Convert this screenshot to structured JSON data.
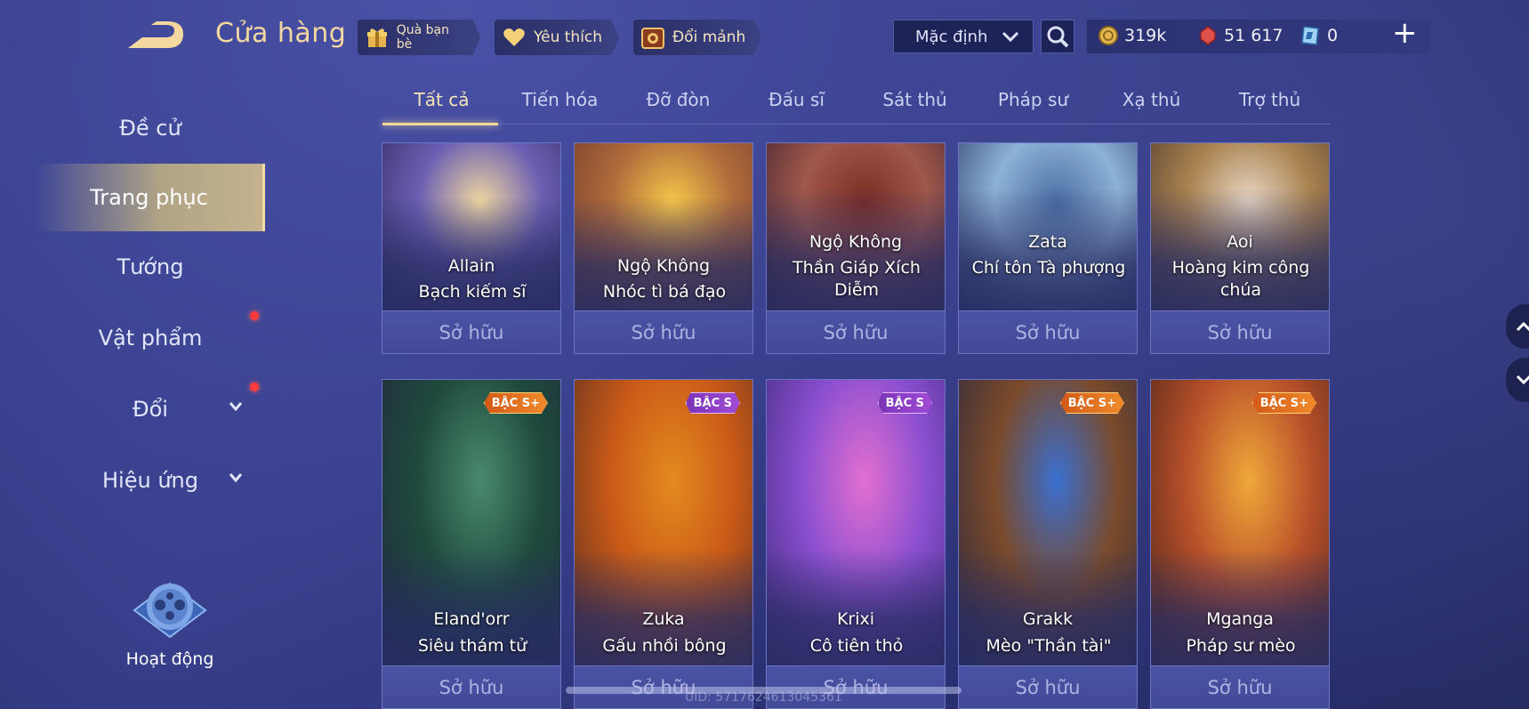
{
  "header": {
    "title": "Cửa hàng",
    "gift_label": "Quà bạn bè",
    "favorite_label": "Yêu thích",
    "exchange_label": "Đổi mảnh",
    "sort_value": "Mặc định",
    "currencies": {
      "gold": "319k",
      "vouchers": "51 617",
      "quan_huy": "0"
    },
    "plus_label": "+"
  },
  "sidebar": {
    "items": [
      {
        "label": "Đề cử"
      },
      {
        "label": "Trang phục"
      },
      {
        "label": "Tướng"
      },
      {
        "label": "Vật phẩm"
      },
      {
        "label": "Đổi"
      },
      {
        "label": "Hiệu ứng"
      }
    ],
    "activity_label": "Hoạt động"
  },
  "tabs": [
    "Tất cả",
    "Tiến hóa",
    "Đỡ đòn",
    "Đấu sĩ",
    "Sát thủ",
    "Pháp sư",
    "Xạ thủ",
    "Trợ thủ"
  ],
  "row1": [
    {
      "hero": "Allain",
      "skin": "Bạch kiếm sĩ",
      "status": "Sở hữu",
      "colors": [
        "#f0d7a0",
        "#6b5fb3",
        "#2f2a5e"
      ]
    },
    {
      "hero": "Ngộ Không",
      "skin": "Nhóc tì bá đạo",
      "status": "Sở hữu",
      "colors": [
        "#f4c64a",
        "#b06a3b",
        "#6e3a2a"
      ]
    },
    {
      "hero": "Ngộ Không",
      "skin": "Thần Giáp Xích Diễm",
      "status": "Sở hữu",
      "colors": [
        "#7a2d25",
        "#a0584a",
        "#3c2030"
      ]
    },
    {
      "hero": "Zata",
      "skin": "Chí tôn Tà phượng",
      "status": "Sở hữu",
      "colors": [
        "#4c6fa5",
        "#8db2d6",
        "#2c3b6a"
      ]
    },
    {
      "hero": "Aoi",
      "skin": "Hoàng kim công chúa",
      "status": "Sở hữu",
      "colors": [
        "#e9d8c6",
        "#a9824f",
        "#4e3a2f"
      ]
    }
  ],
  "row2": [
    {
      "hero": "Eland'orr",
      "skin": "Siêu thám tử",
      "status": "Sở hữu",
      "badge": "BẬC S+",
      "badge_type": "splus",
      "colors": [
        "#4a8a6e",
        "#1f4a3c",
        "#20283f"
      ]
    },
    {
      "hero": "Zuka",
      "skin": "Gấu nhồi bông",
      "status": "Sở hữu",
      "badge": "BẬC S",
      "badge_type": "s",
      "colors": [
        "#e58a1f",
        "#c95a18",
        "#5a2e20"
      ]
    },
    {
      "hero": "Krixi",
      "skin": "Cô tiên thỏ",
      "status": "Sở hữu",
      "badge": "BẬC S",
      "badge_type": "s",
      "colors": [
        "#e26fd0",
        "#8b4fd0",
        "#3e2a7a"
      ]
    },
    {
      "hero": "Grakk",
      "skin": "Mèo \"Thần tài\"",
      "status": "Sở hữu",
      "badge": "BẬC S+",
      "badge_type": "splus",
      "colors": [
        "#3a6fd1",
        "#7a4a2a",
        "#2a2740"
      ]
    },
    {
      "hero": "Mganga",
      "skin": "Pháp sư mèo",
      "status": "Sở hữu",
      "badge": "BẬC S+",
      "badge_type": "splus",
      "colors": [
        "#f0a83a",
        "#b8502a",
        "#4a2418"
      ]
    }
  ],
  "uid_text": "UID: 5717624613045361"
}
